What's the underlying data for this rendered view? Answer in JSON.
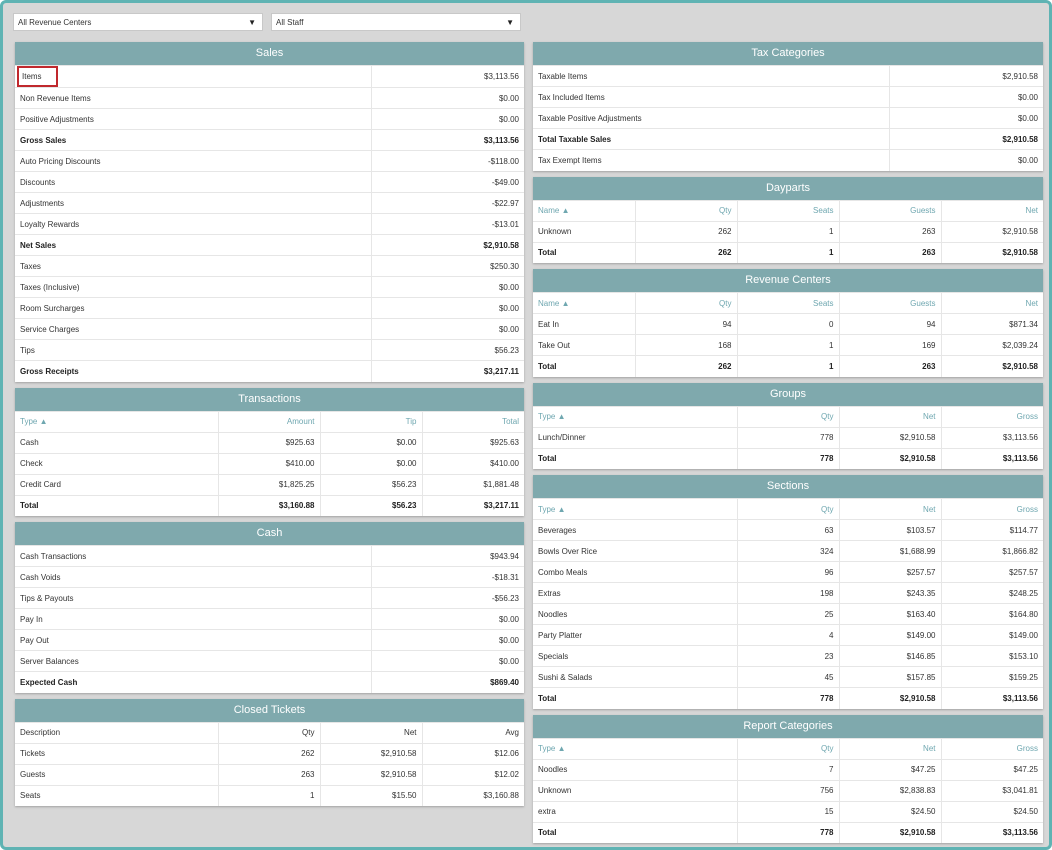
{
  "filters": {
    "revenue_center": "All Revenue Centers",
    "staff": "All Staff"
  },
  "sales": {
    "title": "Sales",
    "rows": [
      {
        "label": "Items",
        "value": "$3,113.56"
      },
      {
        "label": "Non Revenue Items",
        "value": "$0.00"
      },
      {
        "label": "Positive Adjustments",
        "value": "$0.00"
      },
      {
        "label": "Gross Sales",
        "value": "$3,113.56",
        "bold": true
      },
      {
        "label": "Auto Pricing Discounts",
        "value": "-$118.00"
      },
      {
        "label": "Discounts",
        "value": "-$49.00"
      },
      {
        "label": "Adjustments",
        "value": "-$22.97"
      },
      {
        "label": "Loyalty Rewards",
        "value": "-$13.01"
      },
      {
        "label": "Net Sales",
        "value": "$2,910.58",
        "bold": true
      },
      {
        "label": "Taxes",
        "value": "$250.30"
      },
      {
        "label": "Taxes (Inclusive)",
        "value": "$0.00"
      },
      {
        "label": "Room Surcharges",
        "value": "$0.00"
      },
      {
        "label": "Service Charges",
        "value": "$0.00"
      },
      {
        "label": "Tips",
        "value": "$56.23"
      },
      {
        "label": "Gross Receipts",
        "value": "$3,217.11",
        "bold": true
      }
    ]
  },
  "transactions": {
    "title": "Transactions",
    "headers": [
      "Type ▲",
      "Amount",
      "Tip",
      "Total"
    ],
    "rows": [
      [
        "Cash",
        "$925.63",
        "$0.00",
        "$925.63"
      ],
      [
        "Check",
        "$410.00",
        "$0.00",
        "$410.00"
      ],
      [
        "Credit Card",
        "$1,825.25",
        "$56.23",
        "$1,881.48"
      ],
      [
        "Total",
        "$3,160.88",
        "$56.23",
        "$3,217.11"
      ]
    ]
  },
  "cash": {
    "title": "Cash",
    "rows": [
      {
        "label": "Cash Transactions",
        "value": "$943.94"
      },
      {
        "label": "Cash Voids",
        "value": "-$18.31"
      },
      {
        "label": "Tips & Payouts",
        "value": "-$56.23"
      },
      {
        "label": "Pay In",
        "value": "$0.00"
      },
      {
        "label": "Pay Out",
        "value": "$0.00"
      },
      {
        "label": "Server Balances",
        "value": "$0.00"
      },
      {
        "label": "Expected Cash",
        "value": "$869.40",
        "bold": true
      }
    ]
  },
  "closed_tickets": {
    "title": "Closed Tickets",
    "headers": [
      "Description",
      "Qty",
      "Net",
      "Avg"
    ],
    "rows": [
      [
        "Tickets",
        "262",
        "$2,910.58",
        "$12.06"
      ],
      [
        "Guests",
        "263",
        "$2,910.58",
        "$12.02"
      ],
      [
        "Seats",
        "1",
        "$15.50",
        "$3,160.88"
      ]
    ]
  },
  "tax_categories": {
    "title": "Tax Categories",
    "rows": [
      {
        "label": "Taxable Items",
        "value": "$2,910.58"
      },
      {
        "label": "Tax Included Items",
        "value": "$0.00"
      },
      {
        "label": "Taxable Positive Adjustments",
        "value": "$0.00"
      },
      {
        "label": "Total Taxable Sales",
        "value": "$2,910.58",
        "bold": true
      },
      {
        "label": "Tax Exempt Items",
        "value": "$0.00"
      }
    ]
  },
  "dayparts": {
    "title": "Dayparts",
    "headers": [
      "Name ▲",
      "Qty",
      "Seats",
      "Guests",
      "Net"
    ],
    "rows": [
      [
        "Unknown",
        "262",
        "1",
        "263",
        "$2,910.58"
      ],
      [
        "Total",
        "262",
        "1",
        "263",
        "$2,910.58"
      ]
    ]
  },
  "revenue_centers": {
    "title": "Revenue Centers",
    "headers": [
      "Name ▲",
      "Qty",
      "Seats",
      "Guests",
      "Net"
    ],
    "rows": [
      [
        "Eat In",
        "94",
        "0",
        "94",
        "$871.34"
      ],
      [
        "Take Out",
        "168",
        "1",
        "169",
        "$2,039.24"
      ],
      [
        "Total",
        "262",
        "1",
        "263",
        "$2,910.58"
      ]
    ]
  },
  "groups": {
    "title": "Groups",
    "headers": [
      "Type ▲",
      "Qty",
      "Net",
      "Gross"
    ],
    "rows": [
      [
        "Lunch/Dinner",
        "778",
        "$2,910.58",
        "$3,113.56"
      ],
      [
        "Total",
        "778",
        "$2,910.58",
        "$3,113.56"
      ]
    ]
  },
  "sections": {
    "title": "Sections",
    "headers": [
      "Type ▲",
      "Qty",
      "Net",
      "Gross"
    ],
    "rows": [
      [
        "Beverages",
        "63",
        "$103.57",
        "$114.77"
      ],
      [
        "Bowls Over Rice",
        "324",
        "$1,688.99",
        "$1,866.82"
      ],
      [
        "Combo Meals",
        "96",
        "$257.57",
        "$257.57"
      ],
      [
        "Extras",
        "198",
        "$243.35",
        "$248.25"
      ],
      [
        "Noodles",
        "25",
        "$163.40",
        "$164.80"
      ],
      [
        "Party Platter",
        "4",
        "$149.00",
        "$149.00"
      ],
      [
        "Specials",
        "23",
        "$146.85",
        "$153.10"
      ],
      [
        "Sushi & Salads",
        "45",
        "$157.85",
        "$159.25"
      ],
      [
        "Total",
        "778",
        "$2,910.58",
        "$3,113.56"
      ]
    ]
  },
  "report_categories": {
    "title": "Report Categories",
    "headers": [
      "Type ▲",
      "Qty",
      "Net",
      "Gross"
    ],
    "rows": [
      [
        "Noodles",
        "7",
        "$47.25",
        "$47.25"
      ],
      [
        "Unknown",
        "756",
        "$2,838.83",
        "$3,041.81"
      ],
      [
        "extra",
        "15",
        "$24.50",
        "$24.50"
      ],
      [
        "Total",
        "778",
        "$2,910.58",
        "$3,113.56"
      ]
    ]
  }
}
